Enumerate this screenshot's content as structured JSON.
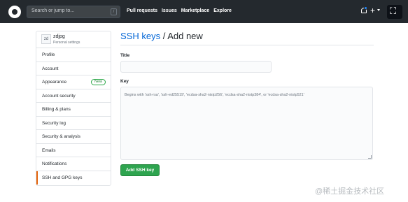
{
  "header": {
    "search_placeholder": "Search or jump to...",
    "search_shortcut": "/",
    "nav": [
      "Pull requests",
      "Issues",
      "Marketplace",
      "Explore"
    ],
    "icons": [
      "github-logo-icon",
      "bell-icon",
      "plus-icon",
      "caret-down-icon",
      "fullscreen-icon"
    ],
    "notification_color": "#2188ff"
  },
  "sidebar": {
    "profile": {
      "avatar_text": "zd",
      "name": "zdjpg",
      "subtitle": "Personal settings"
    },
    "items": [
      {
        "label": "Profile"
      },
      {
        "label": "Account"
      },
      {
        "label": "Appearance",
        "badge": "New"
      },
      {
        "label": "Account security"
      },
      {
        "label": "Billing & plans"
      },
      {
        "label": "Security log"
      },
      {
        "label": "Security & analysis"
      },
      {
        "label": "Emails"
      },
      {
        "label": "Notifications"
      },
      {
        "label": "SSH and GPG keys",
        "selected": true
      }
    ]
  },
  "main": {
    "title_link": "SSH keys",
    "title_rest": " / Add new",
    "title_label": "Title",
    "title_value": "",
    "key_label": "Key",
    "key_placeholder": "Begins with 'ssh-rsa', 'ssh-ed25519', 'ecdsa-sha2-nistp256', 'ecdsa-sha2-nistp384', or 'ecdsa-sha2-nistp521'",
    "submit_label": "Add SSH key"
  },
  "watermark": "@稀土掘金技术社区",
  "colors": {
    "header_bg": "#24292e",
    "link": "#0366d6",
    "button_bg": "#2ea44f",
    "selected_accent": "#e36209"
  }
}
